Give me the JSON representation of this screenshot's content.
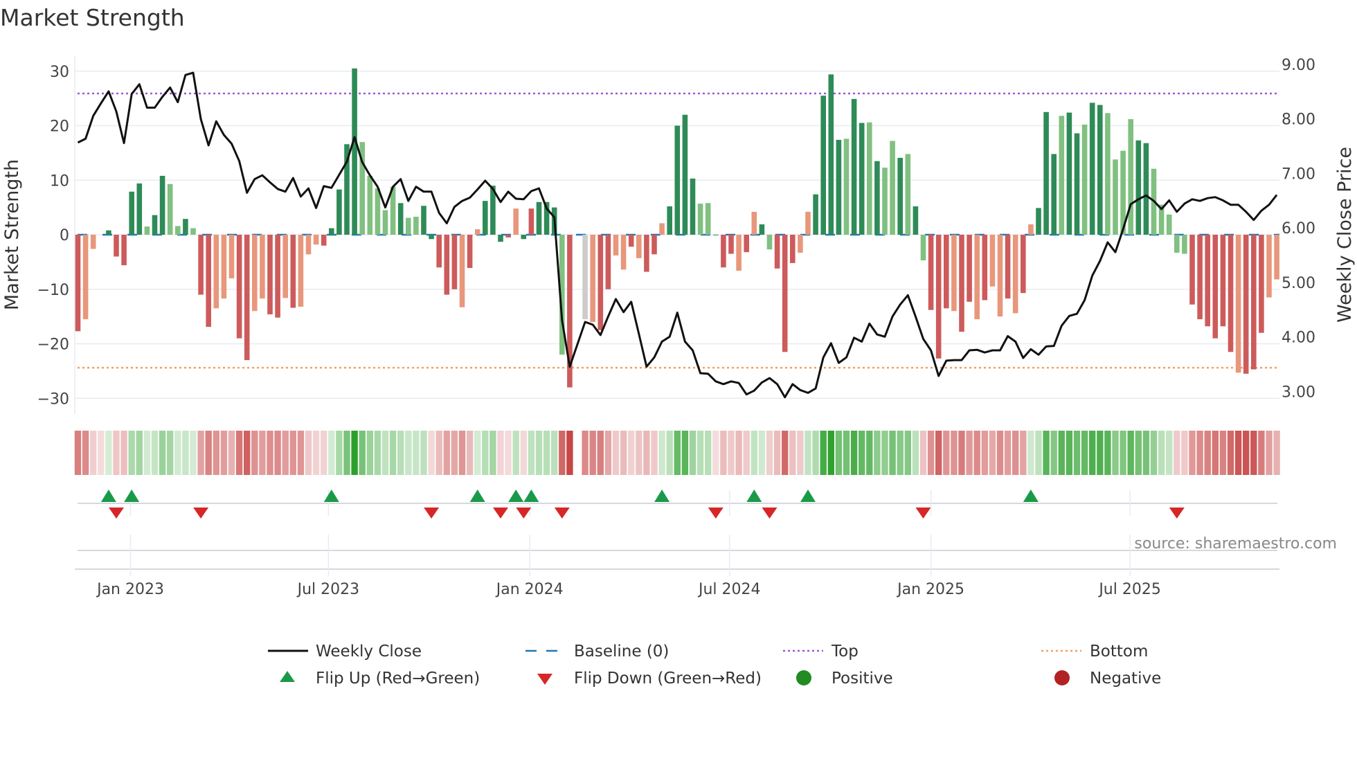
{
  "title": "Market Strength",
  "source": "source: sharemaestro.com",
  "chart_data": {
    "type": "bar+line",
    "title": "Market Strength",
    "ylabel_left": "Market Strength",
    "ylabel_right": "Weekly Close Price",
    "ylim_left": [
      -33,
      33
    ],
    "ylim_right": [
      2.7,
      9.3
    ],
    "yticks_left": [
      "30",
      "20",
      "10",
      "0",
      "−10",
      "−20",
      "−30"
    ],
    "yticks_left_values": [
      30,
      20,
      10,
      0,
      -10,
      -20,
      -30
    ],
    "yticks_right": [
      "9.00",
      "8.00",
      "7.00",
      "6.00",
      "5.00",
      "4.00",
      "3.00"
    ],
    "yticks_right_values": [
      9,
      8,
      7,
      6,
      5,
      4,
      3
    ],
    "xticks": [
      {
        "label": "Jan 2023",
        "week": 6.85
      },
      {
        "label": "Jul 2023",
        "week": 32.6
      },
      {
        "label": "Jan 2024",
        "week": 58.8
      },
      {
        "label": "Jul 2024",
        "week": 84.8
      },
      {
        "label": "Jan 2025",
        "week": 111.0
      },
      {
        "label": "Jul 2025",
        "week": 136.9
      }
    ],
    "grid": true,
    "top_level": 25.9,
    "bottom_level": -24.4,
    "baseline": 0,
    "strength": [
      -17.7,
      -15.5,
      -2.6,
      0,
      0.8,
      -4,
      -5.6,
      7.9,
      9.4,
      1.5,
      3.6,
      10.8,
      9.3,
      1.6,
      2.9,
      1.2,
      -11,
      -16.9,
      -13.5,
      -11.7,
      -8,
      -19,
      -23,
      -14,
      -11.7,
      -14.6,
      -15.2,
      -11.6,
      -13.4,
      -13.2,
      -3.6,
      -1.8,
      -2,
      1.2,
      8.3,
      16.6,
      30.5,
      17,
      10.8,
      8.5,
      4.5,
      8.8,
      5.8,
      3.1,
      3.3,
      5.3,
      -0.8,
      -6,
      -11,
      -10,
      -13.3,
      -6.1,
      1,
      6.2,
      9,
      -1.3,
      -0.5,
      4.8,
      -0.8,
      4.8,
      6,
      6,
      5,
      -22,
      -28,
      null,
      -15.5,
      -16,
      -17.5,
      -10,
      -3.8,
      -6.4,
      -2.2,
      -4.3,
      -6.8,
      -3.6,
      2.1,
      5.2,
      20,
      22,
      10.3,
      5.7,
      5.8,
      -0.1,
      -6,
      -3.5,
      -6.6,
      -3.2,
      4.2,
      1.9,
      -2.7,
      -6.2,
      -21.5,
      -5.2,
      -3.3,
      4.2,
      7.4,
      25.5,
      29.4,
      17.4,
      17.6,
      24.9,
      20.5,
      20.6,
      13.5,
      12.3,
      17.2,
      14.1,
      14.8,
      5.2,
      -4.7,
      -13.8,
      -22.7,
      -13.5,
      -14,
      -17.8,
      -12.3,
      -15.5,
      -12,
      -9.5,
      -15,
      -11.7,
      -14.4,
      -10.7,
      1.9,
      4.9,
      22.5,
      14.8,
      21.8,
      22.4,
      18.6,
      20.2,
      24.2,
      23.8,
      22.3,
      13.8,
      15.4,
      21.2,
      17.3,
      16.8,
      12.1,
      5.5,
      3.7,
      -3.3,
      -3.5,
      -12.8,
      -15.5,
      -16.8,
      -19,
      -16.8,
      -21.5,
      -25.3,
      -25.5,
      -24.7,
      -18,
      -11.5,
      -8.2
    ],
    "strength_state": "RrrnGRRGGgGGggGgRRrrrRRrrRRrRrrrRGGGGgggggGggGGRRRrRrGGGRrGRGGGgRRnrRRrrRrRRrGGGGggGRRrRrGgRRRrrGGGGgGGgGggGgGgRRRrRRrRrrRrRrGGGgGGgGGggggGGgggggRRRRRRrRRRrrrr",
    "weekly_close": [
      7.69,
      7.76,
      8.18,
      8.41,
      8.63,
      8.26,
      7.68,
      8.58,
      8.76,
      8.33,
      8.33,
      8.53,
      8.7,
      8.43,
      8.93,
      8.97,
      8.12,
      7.64,
      8.08,
      7.83,
      7.67,
      7.35,
      6.77,
      7.02,
      7.09,
      6.96,
      6.84,
      6.79,
      7.04,
      6.7,
      6.85,
      6.49,
      6.89,
      6.86,
      7.1,
      7.34,
      7.79,
      7.33,
      7.09,
      6.88,
      6.5,
      6.88,
      7.02,
      6.62,
      6.88,
      6.79,
      6.79,
      6.4,
      6.21,
      6.51,
      6.62,
      6.68,
      6.83,
      6.99,
      6.84,
      6.6,
      6.79,
      6.66,
      6.65,
      6.8,
      6.85,
      6.48,
      6.32,
      4.43,
      3.58,
      3.99,
      4.4,
      4.35,
      4.16,
      4.5,
      4.82,
      4.58,
      4.77,
      4.18,
      3.58,
      3.75,
      4.04,
      4.13,
      4.57,
      4.04,
      3.88,
      3.46,
      3.45,
      3.31,
      3.26,
      3.31,
      3.28,
      3.07,
      3.14,
      3.29,
      3.37,
      3.26,
      3.02,
      3.26,
      3.15,
      3.1,
      3.18,
      3.75,
      4.01,
      3.65,
      3.75,
      4.11,
      4.04,
      4.37,
      4.17,
      4.13,
      4.5,
      4.72,
      4.89,
      4.5,
      4.09,
      3.88,
      3.41,
      3.69,
      3.7,
      3.7,
      3.88,
      3.89,
      3.84,
      3.88,
      3.88,
      4.14,
      4.04,
      3.74,
      3.9,
      3.8,
      3.95,
      3.96,
      4.33,
      4.51,
      4.55,
      4.8,
      5.25,
      5.52,
      5.86,
      5.68,
      6.1,
      6.56,
      6.65,
      6.72,
      6.62,
      6.47,
      6.63,
      6.42,
      6.57,
      6.65,
      6.62,
      6.67,
      6.69,
      6.63,
      6.55,
      6.55,
      6.42,
      6.27,
      6.44,
      6.55,
      6.73
    ],
    "flip_up_weeks": [
      4,
      7,
      33,
      52,
      57,
      59,
      76,
      88,
      95,
      124
    ],
    "flip_down_weeks": [
      5,
      16,
      46,
      55,
      58,
      63,
      83,
      90,
      110,
      143
    ],
    "legend": {
      "placement": "bottom",
      "items": [
        {
          "label": "Weekly Close",
          "symbol": "line"
        },
        {
          "label": "Baseline (0)",
          "symbol": "dash"
        },
        {
          "label": "Top",
          "symbol": "dot"
        },
        {
          "label": "Bottom",
          "symbol": "dot"
        },
        {
          "label": "Flip Up (Red→Green)",
          "symbol": "triangle-up"
        },
        {
          "label": "Flip Down (Green→Red)",
          "symbol": "triangle-down"
        },
        {
          "label": "Positive",
          "symbol": "circle"
        },
        {
          "label": "Negative",
          "symbol": "circle"
        }
      ]
    }
  },
  "colors": {
    "strong_negative": "#cd5b5b",
    "weak_negative": "#e8977c",
    "strong_positive": "#2e8b57",
    "weak_positive": "#80c080",
    "close_line": "#111111",
    "baseline": "#1f77b4",
    "top": "#9b59d6",
    "bottom": "#f0a060",
    "flip_up": "#1a9a48",
    "flip_down": "#d62728",
    "positive": "#228b22",
    "negative": "#b22222"
  }
}
